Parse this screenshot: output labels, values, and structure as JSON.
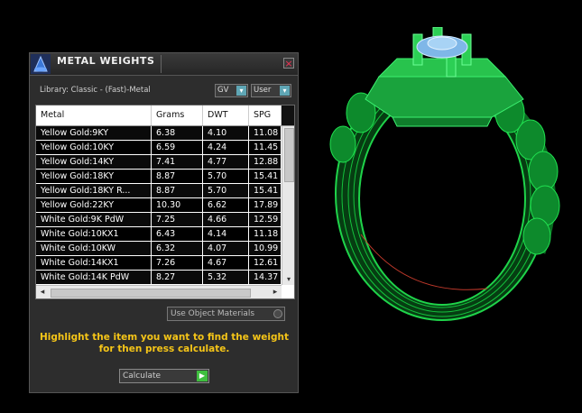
{
  "dialog": {
    "title": "METAL WEIGHTS",
    "close_glyph": "×",
    "library_label": "Library: Classic - (Fast)-Metal",
    "gv_select": "GV",
    "user_select": "User",
    "drop_glyph": "▾",
    "use_object_materials": "Use Object Materials",
    "instruction_line1": "Highlight the item you want to find the weight",
    "instruction_line2": "for then press calculate.",
    "calculate_label": "Calculate",
    "calc_arrow": "▶"
  },
  "table": {
    "columns": [
      "Metal",
      "Grams",
      "DWT",
      "SPG"
    ],
    "rows": [
      [
        "Yellow Gold:9KY",
        "6.38",
        "4.10",
        "11.08"
      ],
      [
        "Yellow Gold:10KY",
        "6.59",
        "4.24",
        "11.45"
      ],
      [
        "Yellow Gold:14KY",
        "7.41",
        "4.77",
        "12.88"
      ],
      [
        "Yellow Gold:18KY",
        "8.87",
        "5.70",
        "15.41"
      ],
      [
        "Yellow Gold:18KY R...",
        "8.87",
        "5.70",
        "15.41"
      ],
      [
        "Yellow Gold:22KY",
        "10.30",
        "6.62",
        "17.89"
      ],
      [
        "White Gold:9K PdW",
        "7.25",
        "4.66",
        "12.59"
      ],
      [
        "White Gold:10KX1",
        "6.43",
        "4.14",
        "11.18"
      ],
      [
        "White Gold:10KW",
        "6.32",
        "4.07",
        "10.99"
      ],
      [
        "White Gold:14KX1",
        "7.26",
        "4.67",
        "12.61"
      ],
      [
        "White Gold:14K PdW",
        "8.27",
        "5.32",
        "14.37"
      ]
    ],
    "scroll_down": "▾",
    "scroll_left": "◂",
    "scroll_right": "▸"
  },
  "colors": {
    "instruction": "#f5c518",
    "ring_wire": "#14c23c",
    "gem": "#7fb7e8"
  }
}
